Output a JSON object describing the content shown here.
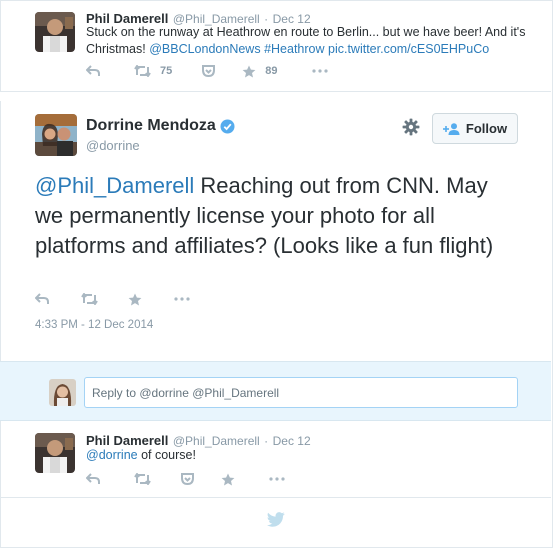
{
  "tweet1": {
    "name": "Phil Damerell",
    "handle": "@Phil_Damerell",
    "dot": "·",
    "date": "Dec 12",
    "text_plain": "Stuck on the runway at Heathrow en route to Berlin... but we have beer! And it's Christmas!",
    "link1": "@BBCLondonNews",
    "link2": "#Heathrow",
    "link3": "pic.twitter.com/cES0EHPuCo",
    "retweets": "75",
    "favorites": "89"
  },
  "focal": {
    "name": "Dorrine Mendoza",
    "handle": "@dorrine",
    "follow_label": "Follow",
    "mention": "@Phil_Damerell",
    "text": " Reaching out from CNN. May we permanently license your photo for all platforms and affiliates? (Looks like a fun flight)",
    "timestamp": "4:33 PM - 12 Dec 2014"
  },
  "reply": {
    "placeholder": "Reply to @dorrine @Phil_Damerell"
  },
  "tweet2": {
    "name": "Phil Damerell",
    "handle": "@Phil_Damerell",
    "dot": "·",
    "date": "Dec 12",
    "mention": "@dorrine",
    "text": " of course!"
  },
  "colors": {
    "link": "#2b7bb9",
    "verified": "#55acee",
    "reply_bg": "#e8f5fd",
    "icon_gray": "#aab8c2"
  },
  "icons": [
    "reply-icon",
    "retweet-icon",
    "pocket-icon",
    "favorite-icon",
    "more-icon",
    "gear-icon",
    "follow-person-icon",
    "verified-badge-icon",
    "twitter-bird-icon"
  ]
}
